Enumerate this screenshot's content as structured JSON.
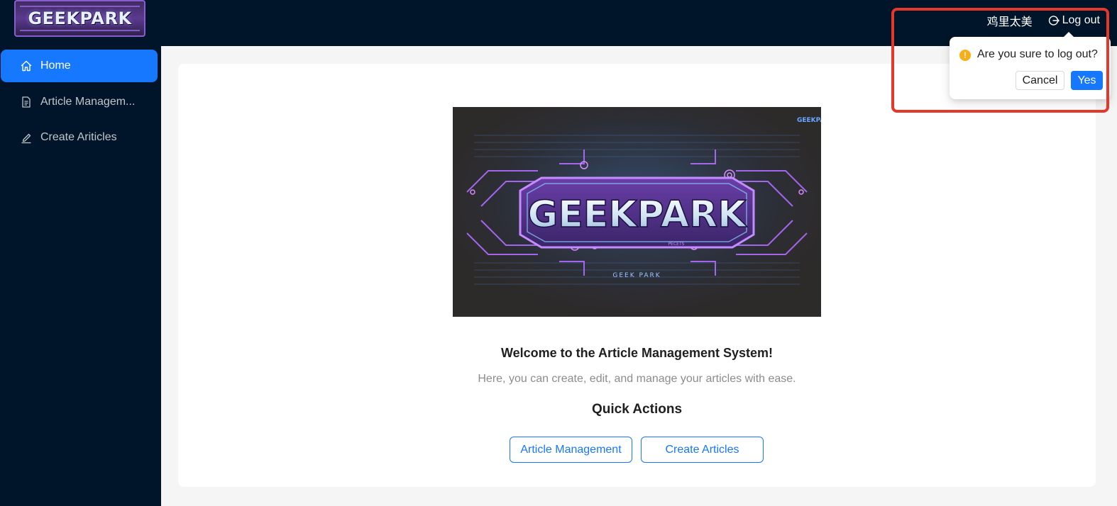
{
  "header": {
    "logo_text": "GEEKPARK",
    "username": "鸡里太美",
    "logout_label": "Log out"
  },
  "sidebar": {
    "items": [
      {
        "label": "Home",
        "icon": "home-icon",
        "active": true
      },
      {
        "label": "Article Managem...",
        "icon": "file-icon",
        "active": false
      },
      {
        "label": "Create Ariticles",
        "icon": "edit-icon",
        "active": false
      }
    ]
  },
  "main": {
    "banner": {
      "title": "GEEKPARK",
      "corner_text": "GEEKPA",
      "subtitle": "GEEK PARK",
      "inner_label": "PECETS"
    },
    "welcome_title": "Welcome to the Article Management System!",
    "welcome_subtitle": "Here, you can create, edit, and manage your articles with ease.",
    "quick_actions_title": "Quick Actions",
    "quick_actions": {
      "article_management": "Article Management",
      "create_articles": "Create Articles"
    }
  },
  "popconfirm": {
    "message": "Are you sure to log out?",
    "cancel_label": "Cancel",
    "yes_label": "Yes",
    "warning_glyph": "!"
  },
  "colors": {
    "header_bg": "#001529",
    "accent": "#1677ff",
    "warning": "#faad14",
    "highlight": "#e5382a"
  }
}
